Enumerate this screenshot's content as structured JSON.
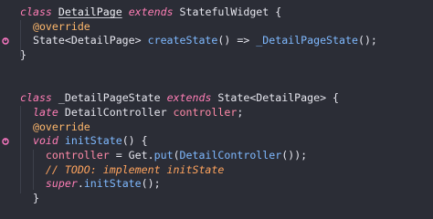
{
  "editor": {
    "lines": [
      {
        "tokens": [
          {
            "text": "class ",
            "kind": "kw"
          },
          {
            "text": "DetailPage",
            "kind": "cls"
          },
          {
            "text": " ",
            "kind": "plain"
          },
          {
            "text": "extends",
            "kind": "kw"
          },
          {
            "text": " StatefulWidget {",
            "kind": "plain"
          }
        ]
      },
      {
        "tokens": [
          {
            "text": "  @override",
            "kind": "ann"
          }
        ]
      },
      {
        "marker": "override-marker-icon",
        "tokens": [
          {
            "text": "  State<DetailPage> ",
            "kind": "plain"
          },
          {
            "text": "createState",
            "kind": "fn"
          },
          {
            "text": "() => ",
            "kind": "plain"
          },
          {
            "text": "_DetailPageState",
            "kind": "fn"
          },
          {
            "text": "();",
            "kind": "plain"
          }
        ]
      },
      {
        "tokens": [
          {
            "text": "}",
            "kind": "plain"
          }
        ]
      },
      {
        "tokens": []
      },
      {
        "tokens": []
      },
      {
        "tokens": [
          {
            "text": "class ",
            "kind": "kw"
          },
          {
            "text": "_DetailPageState ",
            "kind": "plain"
          },
          {
            "text": "extends",
            "kind": "kw"
          },
          {
            "text": " State<DetailPage> {",
            "kind": "plain"
          }
        ]
      },
      {
        "tokens": [
          {
            "text": "  ",
            "kind": "plain"
          },
          {
            "text": "late",
            "kind": "kw"
          },
          {
            "text": " DetailController ",
            "kind": "plain"
          },
          {
            "text": "controller",
            "kind": "var"
          },
          {
            "text": ";",
            "kind": "plain"
          }
        ]
      },
      {
        "tokens": [
          {
            "text": "  @override",
            "kind": "ann"
          }
        ]
      },
      {
        "marker": "override-marker-icon",
        "tokens": [
          {
            "text": "  ",
            "kind": "plain"
          },
          {
            "text": "void",
            "kind": "kw"
          },
          {
            "text": " ",
            "kind": "plain"
          },
          {
            "text": "initState",
            "kind": "fn"
          },
          {
            "text": "() {",
            "kind": "plain"
          }
        ]
      },
      {
        "tokens": [
          {
            "text": "    ",
            "kind": "plain"
          },
          {
            "text": "controller",
            "kind": "var"
          },
          {
            "text": " = Get.",
            "kind": "plain"
          },
          {
            "text": "put",
            "kind": "fn"
          },
          {
            "text": "(",
            "kind": "plain"
          },
          {
            "text": "DetailController",
            "kind": "fn"
          },
          {
            "text": "());",
            "kind": "plain"
          }
        ]
      },
      {
        "tokens": [
          {
            "text": "    ",
            "kind": "plain"
          },
          {
            "text": "// TODO: implement initState",
            "kind": "comment"
          }
        ]
      },
      {
        "tokens": [
          {
            "text": "    ",
            "kind": "plain"
          },
          {
            "text": "super",
            "kind": "kw"
          },
          {
            "text": ".",
            "kind": "plain"
          },
          {
            "text": "initState",
            "kind": "fn"
          },
          {
            "text": "();",
            "kind": "plain"
          }
        ]
      },
      {
        "tokens": [
          {
            "text": "  }",
            "kind": "plain"
          }
        ]
      }
    ]
  },
  "colors": {
    "background": "#2b2d36",
    "keyword": "#ff7eb6",
    "annotation": "#ffb86c",
    "function": "#7fb9ff",
    "variable": "#ff8aa8",
    "comment": "#ffa45e",
    "marker": "#ff79c6"
  }
}
